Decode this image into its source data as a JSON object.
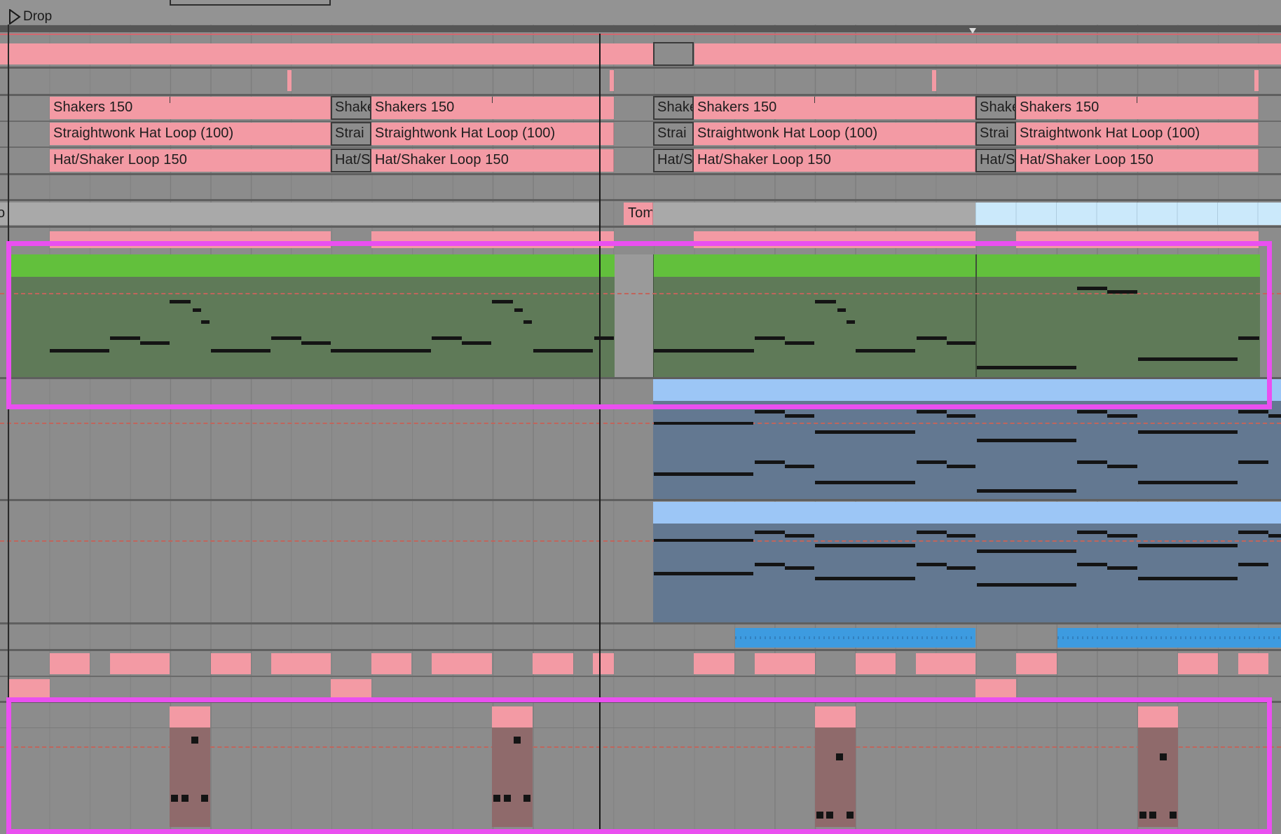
{
  "locator": {
    "label": "Drop"
  },
  "clips": {
    "shakers": "Shakers 150",
    "shakers_short": "Shake",
    "hat_loop": "Straightwonk Hat Loop (100)",
    "hat_loop_short": "Strai",
    "hat_shaker": "Hat/Shaker Loop 150",
    "hat_shaker_short": "Hat/S",
    "tom_short": "Tom",
    "left_cut": "o"
  },
  "colors": {
    "background": "#8c8c8c",
    "clip_pink": "#f39aa4",
    "clip_green": "#62c03c",
    "midi_green_body": "#5f7a58",
    "clip_blue": "#9cc6f6",
    "midi_blue_body": "#637891",
    "clip_light_blue": "#cbe9fb",
    "clip_mid_blue": "#3d9be0",
    "drum_body": "#8f6a6b",
    "highlight": "#ea4ff0"
  },
  "icons": {
    "locator": "play-triangle-icon"
  }
}
